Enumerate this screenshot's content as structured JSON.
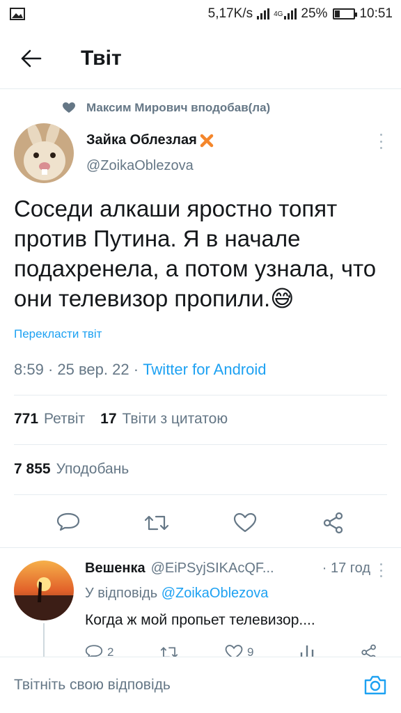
{
  "status_bar": {
    "speed": "5,17K/s",
    "network": "4G",
    "battery": "25%",
    "time": "10:51",
    "battery_level": 0.25
  },
  "header": {
    "title": "Твіт"
  },
  "context": {
    "liked_by": "Максим Мирович вподобав(ла)"
  },
  "tweet": {
    "author_name": "Зайка Облезлая",
    "author_handle": "@ZoikaOblezova",
    "text": "Соседи алкаши яростно топят против Путина. Я в начале подахренела, а потом узнала, что они телевизор пропили.",
    "emoji": "😅",
    "translate_label": "Перекласти твіт",
    "time": "8:59",
    "date": "25 вер. 22",
    "client": "Twitter for Android",
    "retweets_count": "771",
    "retweets_label": "Ретвіт",
    "quotes_count": "17",
    "quotes_label": "Твіти з цитатою",
    "likes_count": "7 855",
    "likes_label": "Уподобань"
  },
  "reply": {
    "name": "Вешенка",
    "handle": "@EiPSyjSIKAcQF...",
    "time": "· 17 год",
    "replying_to_prefix": "У відповідь",
    "replying_to": "@ZoikaOblezova",
    "text": "Когда ж мой пропьет телевизор....",
    "reply_count": "2",
    "like_count": "9"
  },
  "composer": {
    "placeholder": "Твітніть свою відповідь"
  },
  "colors": {
    "accent": "#1da1f2",
    "secondary_text": "#657786",
    "primary_text": "#14171a",
    "divider": "#e6ecf0",
    "verified_mark": "#f4862b"
  }
}
